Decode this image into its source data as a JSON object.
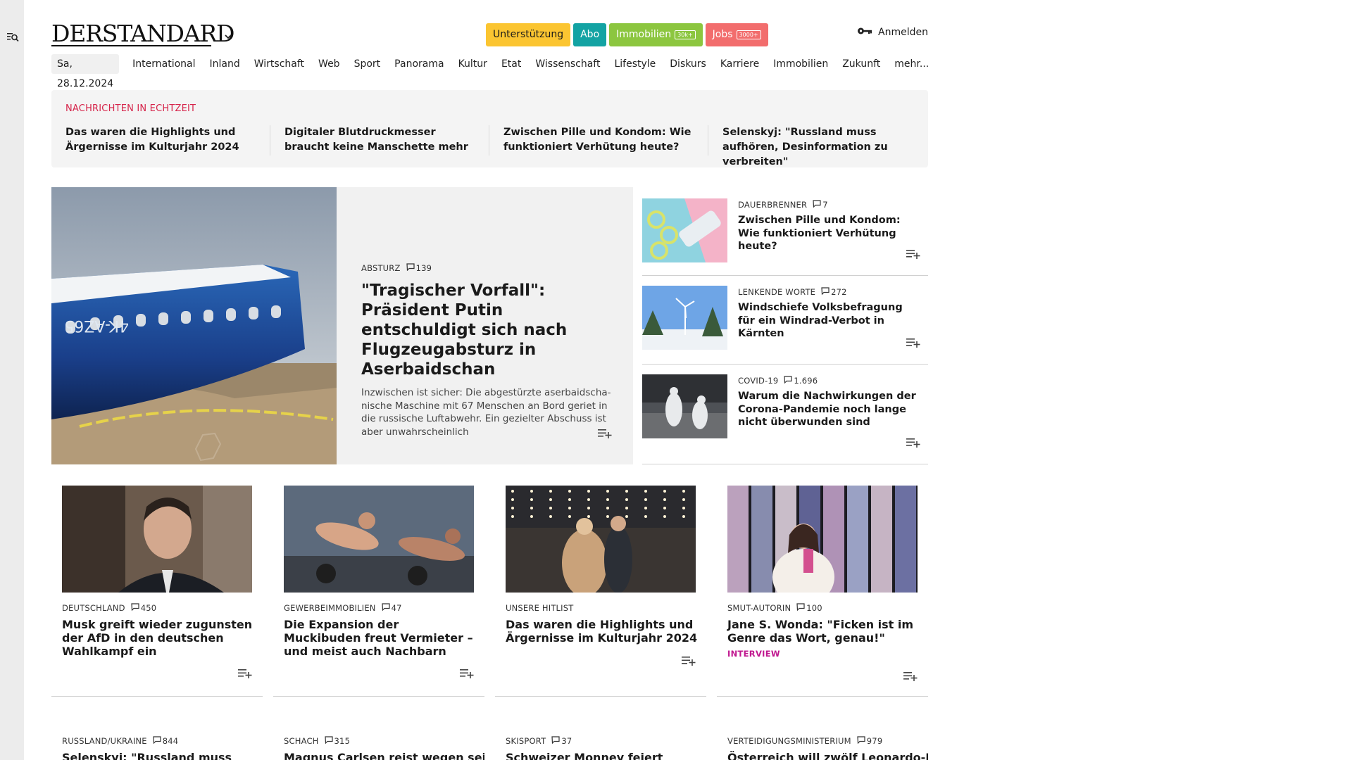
{
  "header": {
    "logo": "DERSTANDARD",
    "pills": [
      {
        "label": "Unterstützung",
        "bg": "#fbc531",
        "fg": "#1a1a1a",
        "badge": ""
      },
      {
        "label": "Abo",
        "bg": "#13a3a3",
        "fg": "#ffffff",
        "badge": ""
      },
      {
        "label": "Immobilien",
        "bg": "#8cc63f",
        "fg": "#ffffff",
        "badge": "30k+"
      },
      {
        "label": "Jobs",
        "bg": "#f26d6d",
        "fg": "#ffffff",
        "badge": "3000+"
      }
    ],
    "login": "Anmelden"
  },
  "nav": {
    "date": "Sa, 28.12.2024",
    "items": [
      "International",
      "Inland",
      "Wirtschaft",
      "Web",
      "Sport",
      "Panorama",
      "Kultur",
      "Etat",
      "Wissenschaft",
      "Lifestyle",
      "Diskurs",
      "Karriere",
      "Immobilien",
      "Zukunft",
      "mehr..."
    ]
  },
  "ticker": {
    "title": "NACHRICHTEN IN ECHTZEIT",
    "items": [
      "Das waren die Highlights und Ärger­nisse im Kulturjahr 2024",
      "Digitaler Blutdruckmesser braucht keine Manschette mehr",
      "Zwischen Pille und Kondom: Wie funktioniert Verhütung heute?",
      "Selenskyj: \"Russland muss aufhören, Desinformation zu verbreiten\""
    ]
  },
  "hero": {
    "kicker": "ABSTURZ",
    "comments": "139",
    "title": "\"Tragischer Vorfall\": Präsident Putin entschuldigt sich nach Flugzeugabsturz in Aserbaidschan",
    "subtitle": "Inzwischen ist sicher: Die abgestürzte aserbaidscha­nische Maschine mit 67 Menschen an Bord geriet in die russische Luftabwehr. Ein gezielter Abschuss ist aber unwahrscheinlich",
    "plane_reg": "4K-AZ65"
  },
  "side": [
    {
      "kicker": "DAUERBRENNER",
      "comments": "7",
      "title": "Zwischen Pille und Kondom: Wie funktioniert Verhütung heute?"
    },
    {
      "kicker": "LENKENDE WORTE",
      "comments": "272",
      "title": "Windschiefe Volksbefragung für ein Windrad-Verbot in Kärnten"
    },
    {
      "kicker": "COVID-19",
      "comments": "1.696",
      "title": "Warum die Nachwirkungen der Corona-Pandemie noch lange nicht überwunden sind"
    }
  ],
  "cards": [
    {
      "kicker": "DEUTSCHLAND",
      "comments": "450",
      "title": "Musk greift wieder zugunsten der AfD in den deutschen Wahlkampf ein",
      "tag": ""
    },
    {
      "kicker": "GEWERBEIMMOBILIEN",
      "comments": "47",
      "title": "Die Expansion der Muckibuden freut Vermieter – und meist auch Nachbarn",
      "tag": ""
    },
    {
      "kicker": "UNSERE HITLIST",
      "comments": "",
      "title": "Das waren die Highlights und Ärgernisse im Kulturjahr 2024",
      "tag": ""
    },
    {
      "kicker": "SMUT-AUTORIN",
      "comments": "100",
      "title": "Jane S. Wonda: \"Ficken ist im Genre das Wort, genau!\"",
      "tag": "INTERVIEW"
    }
  ],
  "row2": [
    {
      "kicker": "RUSSLAND/UKRAINE",
      "comments": "844",
      "title": "Selenskyj: \"Russland muss"
    },
    {
      "kicker": "SCHACH",
      "comments": "315",
      "title": "Magnus Carlsen reist wegen seiner"
    },
    {
      "kicker": "SKISPORT",
      "comments": "37",
      "title": "Schweizer Monney feiert"
    },
    {
      "kicker": "VERTEIDIGUNGSMINISTERIUM",
      "comments": "979",
      "title": "Österreich will zwölf Leonardo-M-"
    }
  ],
  "icons": {
    "menu": "menu-search-icon",
    "chevron": "chevron-down-icon",
    "key": "key-icon",
    "comment": "comment-icon",
    "add": "add-to-list-icon"
  }
}
